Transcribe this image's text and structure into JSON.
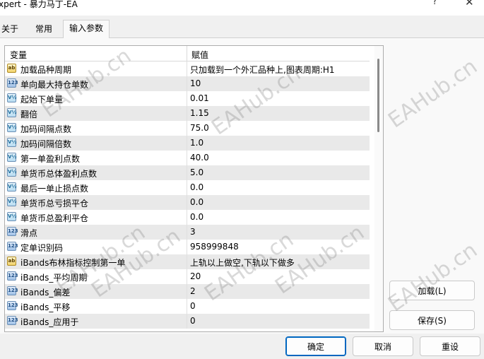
{
  "window": {
    "title": "xpert - 暴力马丁-EA",
    "help_glyph": "?",
    "close_glyph": "✕"
  },
  "tabs": [
    {
      "label": "关于"
    },
    {
      "label": "常用"
    },
    {
      "label": "输入参数"
    }
  ],
  "table": {
    "headers": {
      "name": "变量",
      "value": "赋值"
    },
    "rows": [
      {
        "icon": "ab",
        "name": "加载品种周期",
        "value": "只加载到一个外汇品种上,图表周期:H1"
      },
      {
        "icon": "123",
        "name": "单向最大持仓单数",
        "value": "10"
      },
      {
        "icon": "V½",
        "name": "起始下单量",
        "value": "0.01"
      },
      {
        "icon": "V½",
        "name": "翻倍",
        "value": "1.15"
      },
      {
        "icon": "V½",
        "name": "加码间隔点数",
        "value": "75.0"
      },
      {
        "icon": "V½",
        "name": "加码间隔倍数",
        "value": "1.0"
      },
      {
        "icon": "V½",
        "name": "第一单盈利点数",
        "value": "40.0"
      },
      {
        "icon": "V½",
        "name": "单货币总体盈利点数",
        "value": "5.0"
      },
      {
        "icon": "V½",
        "name": "最后一单止损点数",
        "value": "0.0"
      },
      {
        "icon": "V½",
        "name": "单货币总亏损平仓",
        "value": "0.0"
      },
      {
        "icon": "V½",
        "name": "单货币总盈利平仓",
        "value": "0.0"
      },
      {
        "icon": "123",
        "name": "滑点",
        "value": "3"
      },
      {
        "icon": "123",
        "name": "定单识别码",
        "value": "958999848"
      },
      {
        "icon": "ab",
        "name": "iBands布林指标控制第一单",
        "value": "上轨以上做空,下轨以下做多"
      },
      {
        "icon": "123",
        "name": "iBands_平均周期",
        "value": "20"
      },
      {
        "icon": "123",
        "name": "iBands_偏差",
        "value": "2"
      },
      {
        "icon": "123",
        "name": "iBands_平移",
        "value": "0"
      },
      {
        "icon": "123",
        "name": "iBands_应用于",
        "value": "0"
      }
    ]
  },
  "side_buttons": {
    "load": "加载(L)",
    "save": "保存(S)"
  },
  "footer_buttons": {
    "ok": "确定",
    "cancel": "取消",
    "reset": "重设"
  },
  "watermarks": [
    "EAHub.cn",
    "EAHub.cn",
    "EAHub.cn",
    "EAHub.cn",
    "EAHub.cn",
    "EAHub.cn",
    "EAHub.cn",
    "EAHub.cn"
  ]
}
